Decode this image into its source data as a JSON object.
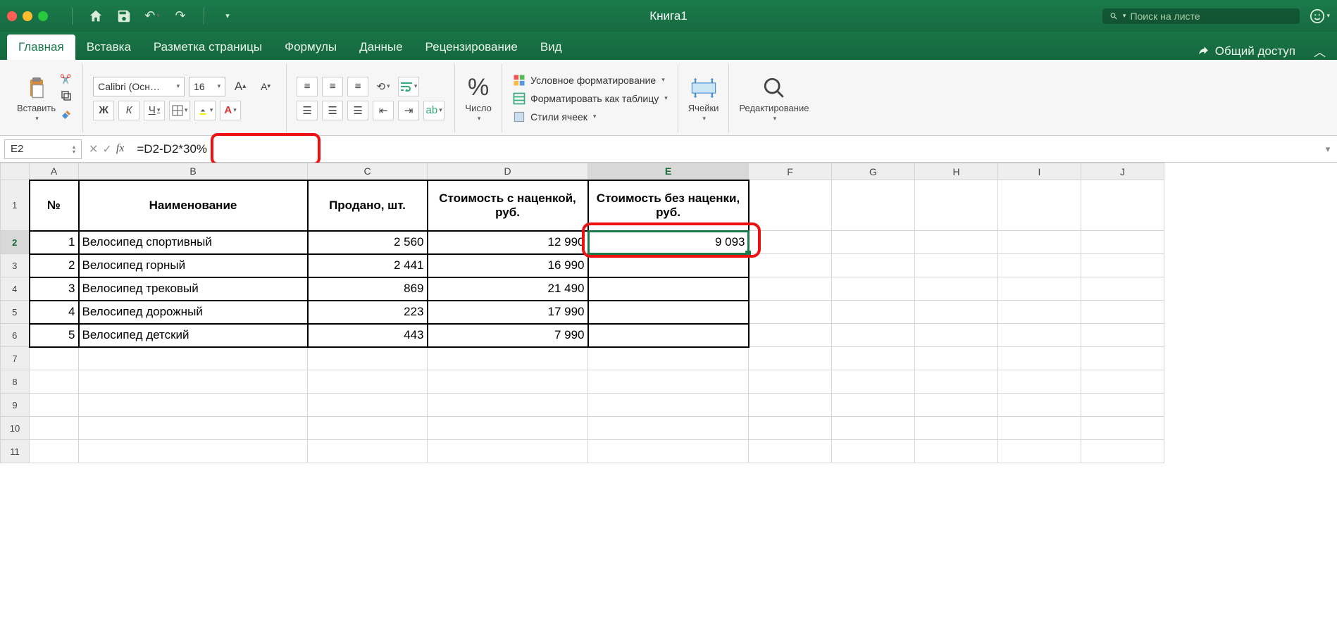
{
  "titlebar": {
    "title": "Книга1",
    "search_placeholder": "Поиск на листе"
  },
  "tabs": {
    "items": [
      "Главная",
      "Вставка",
      "Разметка страницы",
      "Формулы",
      "Данные",
      "Рецензирование",
      "Вид"
    ],
    "share": "Общий доступ"
  },
  "ribbon": {
    "paste": "Вставить",
    "font_name": "Calibri (Осн…",
    "font_size": "16",
    "bold": "Ж",
    "italic": "К",
    "underline": "Ч",
    "number": "Число",
    "cond_format": "Условное форматирование",
    "as_table": "Форматировать как таблицу",
    "cell_styles": "Стили ячеек",
    "cells": "Ячейки",
    "editing": "Редактирование"
  },
  "formula_bar": {
    "name_box": "E2",
    "formula": "=D2-D2*30%"
  },
  "columns": [
    "A",
    "B",
    "C",
    "D",
    "E",
    "F",
    "G",
    "H",
    "I",
    "J"
  ],
  "rows": [
    "1",
    "2",
    "3",
    "4",
    "5",
    "6",
    "7",
    "8",
    "9",
    "10",
    "11"
  ],
  "sheet": {
    "header": {
      "A": "№",
      "B": "Наименование",
      "C": "Продано, шт.",
      "D": "Стоимость с наценкой, руб.",
      "E": "Стоимость без наценки, руб."
    },
    "data": [
      {
        "n": "1",
        "name": "Велосипед спортивный",
        "sold": "2 560",
        "markup": "12 990",
        "nomarkup": "9 093"
      },
      {
        "n": "2",
        "name": "Велосипед горный",
        "sold": "2 441",
        "markup": "16 990",
        "nomarkup": ""
      },
      {
        "n": "3",
        "name": "Велосипед трековый",
        "sold": "869",
        "markup": "21 490",
        "nomarkup": ""
      },
      {
        "n": "4",
        "name": "Велосипед дорожный",
        "sold": "223",
        "markup": "17 990",
        "nomarkup": ""
      },
      {
        "n": "5",
        "name": "Велосипед детский",
        "sold": "443",
        "markup": "7 990",
        "nomarkup": ""
      }
    ]
  }
}
